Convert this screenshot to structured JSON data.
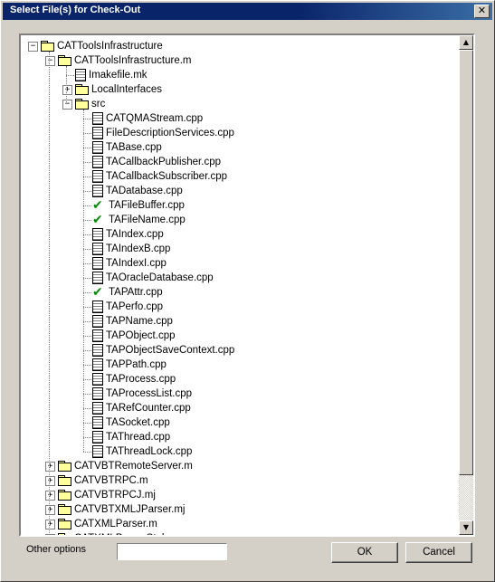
{
  "window": {
    "title": "Select File(s) for Check-Out",
    "close_glyph": "✕"
  },
  "tree": {
    "rows": [
      {
        "label": "CATToolsInfrastructure",
        "icon": "folder",
        "expander": "−",
        "level": 0
      },
      {
        "label": "CATToolsInfrastructure.m",
        "icon": "folder",
        "expander": "−",
        "level": 1
      },
      {
        "label": "Imakefile.mk",
        "icon": "file",
        "level": 2
      },
      {
        "label": "LocalInterfaces",
        "icon": "folder",
        "expander": "+",
        "level": 2
      },
      {
        "label": "src",
        "icon": "folder",
        "expander": "−",
        "level": 2
      },
      {
        "label": "CATQMAStream.cpp",
        "icon": "file",
        "level": 3
      },
      {
        "label": "FileDescriptionServices.cpp",
        "icon": "file",
        "level": 3
      },
      {
        "label": "TABase.cpp",
        "icon": "file",
        "level": 3
      },
      {
        "label": "TACallbackPublisher.cpp",
        "icon": "file",
        "level": 3
      },
      {
        "label": "TACallbackSubscriber.cpp",
        "icon": "file",
        "level": 3
      },
      {
        "label": "TADatabase.cpp",
        "icon": "file",
        "level": 3
      },
      {
        "label": "TAFileBuffer.cpp",
        "icon": "check",
        "level": 3
      },
      {
        "label": "TAFileName.cpp",
        "icon": "check",
        "level": 3
      },
      {
        "label": "TAIndex.cpp",
        "icon": "file",
        "level": 3
      },
      {
        "label": "TAIndexB.cpp",
        "icon": "file",
        "level": 3
      },
      {
        "label": "TAIndexI.cpp",
        "icon": "file",
        "level": 3
      },
      {
        "label": "TAOracleDatabase.cpp",
        "icon": "file",
        "level": 3
      },
      {
        "label": "TAPAttr.cpp",
        "icon": "check",
        "level": 3
      },
      {
        "label": "TAPerfo.cpp",
        "icon": "file",
        "level": 3
      },
      {
        "label": "TAPName.cpp",
        "icon": "file",
        "level": 3
      },
      {
        "label": "TAPObject.cpp",
        "icon": "file",
        "level": 3
      },
      {
        "label": "TAPObjectSaveContext.cpp",
        "icon": "file",
        "level": 3
      },
      {
        "label": "TAPPath.cpp",
        "icon": "file",
        "level": 3
      },
      {
        "label": "TAProcess.cpp",
        "icon": "file",
        "level": 3
      },
      {
        "label": "TAProcessList.cpp",
        "icon": "file",
        "level": 3
      },
      {
        "label": "TARefCounter.cpp",
        "icon": "file",
        "level": 3
      },
      {
        "label": "TASocket.cpp",
        "icon": "file",
        "level": 3
      },
      {
        "label": "TAThread.cpp",
        "icon": "file",
        "level": 3
      },
      {
        "label": "TAThreadLock.cpp",
        "icon": "file",
        "level": 3
      },
      {
        "label": "CATVBTRemoteServer.m",
        "icon": "folder",
        "expander": "+",
        "level": 1
      },
      {
        "label": "CATVBTRPC.m",
        "icon": "folder",
        "expander": "+",
        "level": 1
      },
      {
        "label": "CATVBTRPCJ.mj",
        "icon": "folder",
        "expander": "+",
        "level": 1
      },
      {
        "label": "CATVBTXMLJParser.mj",
        "icon": "folder",
        "expander": "+",
        "level": 1
      },
      {
        "label": "CATXMLParser.m",
        "icon": "folder",
        "expander": "+",
        "level": 1
      },
      {
        "label": "CATXMLParserStub.m",
        "icon": "folder",
        "expander": "+",
        "level": 1
      }
    ],
    "scroll_up_glyph": "▲",
    "scroll_down_glyph": "▼"
  },
  "footer": {
    "other_options_label": "Other options",
    "other_options_value": "",
    "ok_label": "OK",
    "cancel_label": "Cancel"
  }
}
